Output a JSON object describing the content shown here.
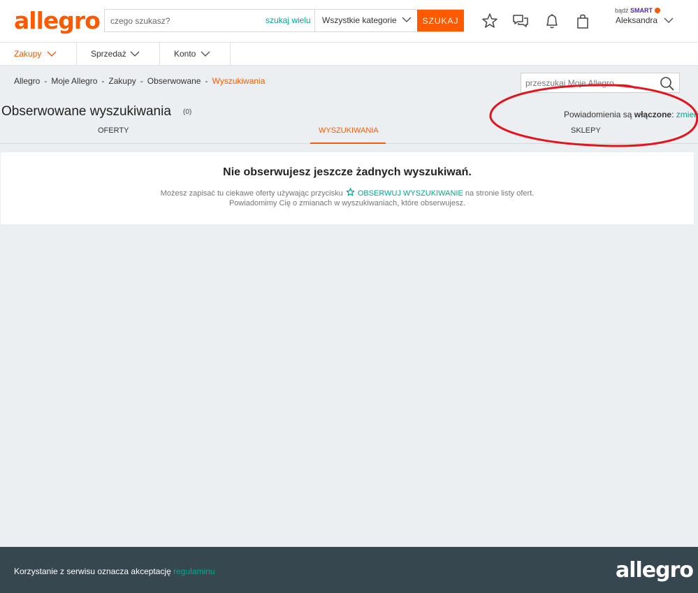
{
  "header": {
    "logo": "allegro",
    "search_placeholder": "czego szukasz?",
    "search_many": "szukaj wielu",
    "category": "Wszystkie kategorie",
    "search_button": "SZUKAJ",
    "smart_prefix": "bądź",
    "smart_label": "SMART",
    "user_name": "Aleksandra"
  },
  "nav": {
    "items": [
      {
        "label": "Zakupy"
      },
      {
        "label": "Sprzedaż"
      },
      {
        "label": "Konto"
      }
    ]
  },
  "breadcrumb": {
    "items": [
      "Allegro",
      "Moje Allegro",
      "Zakupy",
      "Obserwowane"
    ],
    "current": "Wyszukiwania",
    "separator": "-"
  },
  "my_search_placeholder": "przeszukaj Moje Allegro",
  "page": {
    "title": "Obserwowane wyszukiwania",
    "count": "(0)",
    "notif_prefix": "Powiadomienia są",
    "notif_state": "włączone",
    "notif_colon": ":",
    "notif_change": "zmień"
  },
  "tabs": [
    {
      "label": "OFERTY"
    },
    {
      "label": "WYSZUKIWANIA"
    },
    {
      "label": "SKLEPY"
    }
  ],
  "empty_state": {
    "title": "Nie obserwujesz jeszcze żadnych wyszukiwań.",
    "line1_before": "Możesz zapisać tu ciekawe oferty używając przycisku",
    "line1_button": "OBSERWUJ WYSZUKIWANIE",
    "line1_after": "na stronie listy ofert.",
    "line2": "Powiadomimy Cię o zmianach w wyszukiwaniach, które obserwujesz."
  },
  "footer": {
    "text": "Korzystanie z serwisu oznacza akceptację",
    "link": "regulaminu",
    "logo": "allegro"
  },
  "colors": {
    "brand": "#ff5a00",
    "link": "#00a790",
    "footer_bg": "#37474f",
    "annotation": "#e0151f"
  }
}
